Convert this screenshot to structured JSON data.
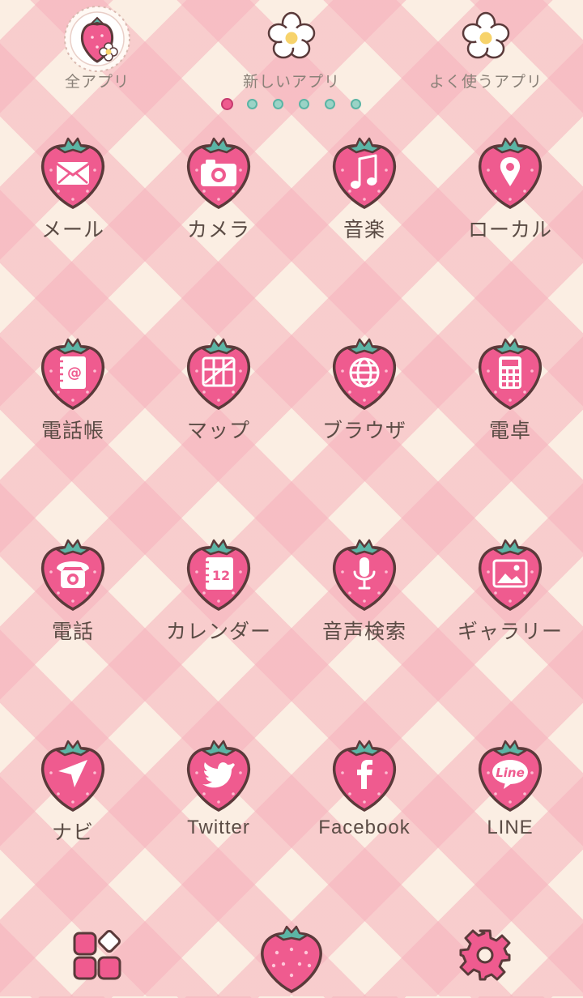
{
  "colors": {
    "berry": "#ef5b8f",
    "berry_outline": "#5a3a3a",
    "leaf": "#5bb5a5",
    "accent": "#c8477a",
    "label": "#5b4c45",
    "tab_label": "#8a8178",
    "check_pink": "#f6b2bc",
    "check_cream": "#fbeee3"
  },
  "tabs": [
    {
      "label": "全アプリ",
      "icon": "strawberry-badge-icon"
    },
    {
      "label": "新しいアプリ",
      "icon": "daisy-icon"
    },
    {
      "label": "よく使うアプリ",
      "icon": "daisy-icon"
    }
  ],
  "page_indicator": {
    "count": 6,
    "active": 1
  },
  "apps": [
    {
      "label": "メール",
      "icon": "envelope-icon"
    },
    {
      "label": "カメラ",
      "icon": "camera-icon"
    },
    {
      "label": "音楽",
      "icon": "music-note-icon"
    },
    {
      "label": "ローカル",
      "icon": "map-pin-icon"
    },
    {
      "label": "電話帳",
      "icon": "address-book-icon"
    },
    {
      "label": "マップ",
      "icon": "map-icon"
    },
    {
      "label": "ブラウザ",
      "icon": "globe-icon"
    },
    {
      "label": "電卓",
      "icon": "calculator-icon"
    },
    {
      "label": "電話",
      "icon": "telephone-icon"
    },
    {
      "label": "カレンダー",
      "icon": "calendar-icon",
      "calendar_day": "12"
    },
    {
      "label": "音声検索",
      "icon": "microphone-icon"
    },
    {
      "label": "ギャラリー",
      "icon": "picture-icon"
    },
    {
      "label": "ナビ",
      "icon": "navigation-arrow-icon"
    },
    {
      "label": "Twitter",
      "icon": "twitter-bird-icon"
    },
    {
      "label": "Facebook",
      "icon": "facebook-icon"
    },
    {
      "label": "LINE",
      "icon": "line-bubble-icon",
      "badge_text": "Line"
    }
  ],
  "dock": [
    {
      "icon": "app-drawer-icon"
    },
    {
      "icon": "strawberry-icon"
    },
    {
      "icon": "settings-gear-icon"
    }
  ]
}
